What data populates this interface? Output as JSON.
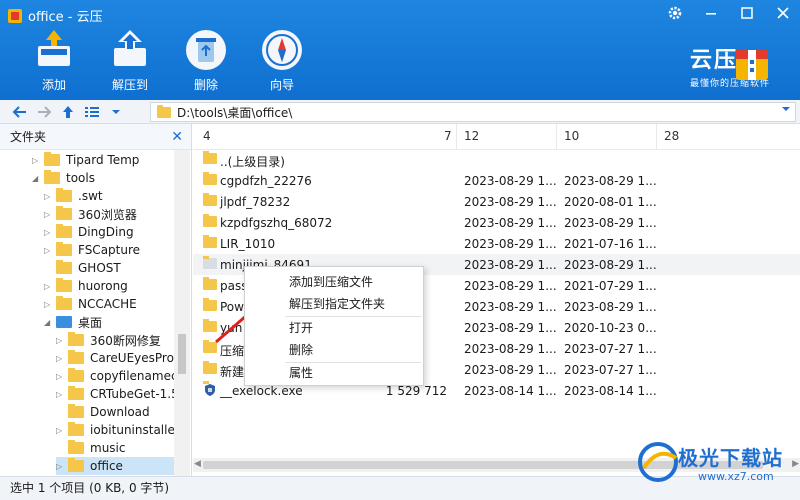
{
  "window": {
    "title": "office - 云压"
  },
  "toolbar": {
    "items": [
      {
        "label": "添加"
      },
      {
        "label": "解压到"
      },
      {
        "label": "删除"
      },
      {
        "label": "向导"
      }
    ]
  },
  "brand": {
    "title": "云压",
    "subtitle": "最懂你的压缩软件"
  },
  "address": {
    "path": "D:\\tools\\桌面\\office\\"
  },
  "tree": {
    "header": "文件夹",
    "items": [
      {
        "label": "Tipard Temp"
      },
      {
        "label": "tools"
      },
      {
        "label": ".swt"
      },
      {
        "label": "360浏览器"
      },
      {
        "label": "DingDing"
      },
      {
        "label": "FSCapture"
      },
      {
        "label": "GHOST"
      },
      {
        "label": "huorong"
      },
      {
        "label": "NCCACHE"
      },
      {
        "label": "桌面"
      },
      {
        "label": "360断网修复"
      },
      {
        "label": "CareUEyesPro"
      },
      {
        "label": "copyfilenamecr"
      },
      {
        "label": "CRTubeGet-1.5"
      },
      {
        "label": "Download"
      },
      {
        "label": "iobituninstaller"
      },
      {
        "label": "music"
      },
      {
        "label": "office"
      }
    ]
  },
  "list": {
    "headers": [
      "4",
      "7",
      "12",
      "10",
      "28"
    ],
    "rows": [
      {
        "name": "..(上级目录)",
        "size": "",
        "d1": "",
        "d2": ""
      },
      {
        "name": "cgpdfzh_22276",
        "size": "",
        "d1": "2023-08-29 1...",
        "d2": "2023-08-29 1..."
      },
      {
        "name": "jlpdf_78232",
        "size": "",
        "d1": "2023-08-29 1...",
        "d2": "2020-08-01 1..."
      },
      {
        "name": "kzpdfgszhq_68072",
        "size": "",
        "d1": "2023-08-29 1...",
        "d2": "2023-08-29 1..."
      },
      {
        "name": "LIR_1010",
        "size": "",
        "d1": "2023-08-29 1...",
        "d2": "2021-07-16 1..."
      },
      {
        "name": "minjiimi_84691",
        "size": "",
        "d1": "2023-08-29 1...",
        "d2": "2023-08-29 1..."
      },
      {
        "name": "pass",
        "size": "",
        "d1": "2023-08-29 1...",
        "d2": "2021-07-29 1..."
      },
      {
        "name": "Pow",
        "size": "",
        "d1": "2023-08-29 1...",
        "d2": "2023-08-29 1..."
      },
      {
        "name": "yun",
        "size": "",
        "d1": "2023-08-29 1...",
        "d2": "2020-10-23 0..."
      },
      {
        "name": "压缩",
        "size": "",
        "d1": "2023-08-29 1...",
        "d2": "2023-07-27 1..."
      },
      {
        "name": "新建",
        "size": "",
        "d1": "2023-08-29 1...",
        "d2": "2023-07-27 1..."
      },
      {
        "name": "__exelock.exe",
        "size": "1 529 712",
        "d1": "2023-08-14 1...",
        "d2": "2023-08-14 1..."
      }
    ]
  },
  "context_menu": {
    "items": [
      "添加到压缩文件",
      "解压到指定文件夹",
      "打开",
      "删除",
      "属性"
    ]
  },
  "status": {
    "text": "选中 1 个项目 (0 KB, 0 字节)"
  },
  "watermark": {
    "text": "极光下载站",
    "url": "www.xz7.com"
  },
  "colors": {
    "header": "#1677dc",
    "accent": "#1a6fd1",
    "folder": "#f4c74a",
    "selected": "#cce4f7"
  }
}
